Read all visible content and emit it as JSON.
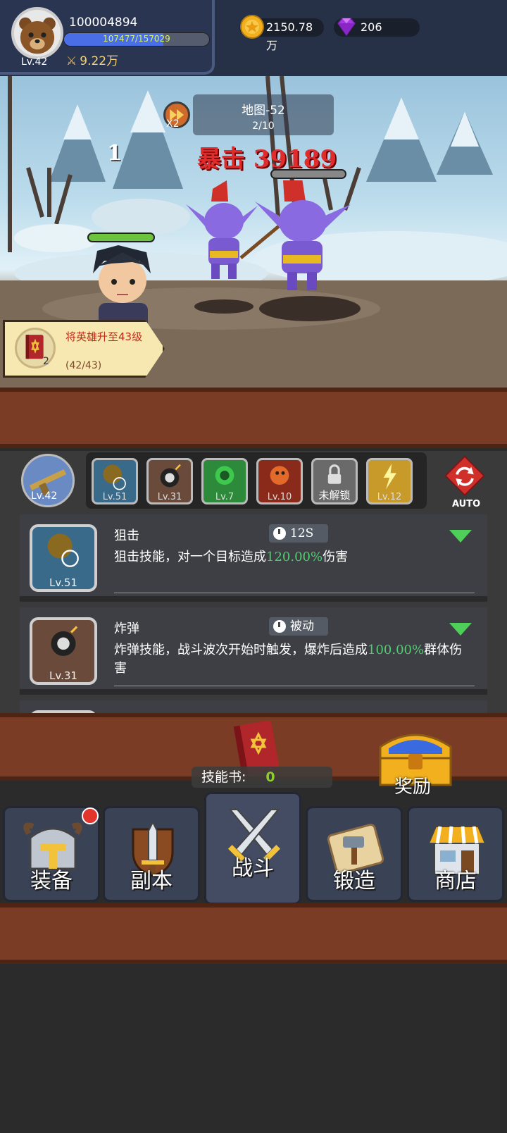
{
  "player": {
    "id": "100004894",
    "level": "Lv.42",
    "exp_text": "107477/157029",
    "exp_fraction": 0.6845,
    "power": "9.22万"
  },
  "resources": {
    "gold": "2150.78万",
    "gems": "206"
  },
  "battle": {
    "speed": "X2",
    "map_name": "地图-52",
    "wave": "2/10",
    "damage_small": "1",
    "damage_crit": "暴击 39189"
  },
  "quest": {
    "title": "将英雄升至43级",
    "count": "2",
    "progress": "(42/43)"
  },
  "skills": {
    "weapon_level": "Lv.42",
    "slots": [
      {
        "label": "Lv.51",
        "icon": "sniper-icon"
      },
      {
        "label": "Lv.31",
        "icon": "bomb-icon"
      },
      {
        "label": "Lv.7",
        "icon": "poison-icon"
      },
      {
        "label": "Lv.10",
        "icon": "fire-icon"
      },
      {
        "label": "未解锁",
        "icon": "lock-icon"
      },
      {
        "label": "Lv.12",
        "icon": "lightning-icon"
      }
    ],
    "auto_label": "AUTO",
    "list": [
      {
        "name": "狙击",
        "level": "Lv.51",
        "cooldown": "12S",
        "desc_prefix": "狙击技能，对一个目标造成",
        "desc_value": "120.00%",
        "desc_suffix": "伤害"
      },
      {
        "name": "炸弹",
        "level": "Lv.31",
        "cooldown": "被动",
        "desc_prefix": "炸弹技能，战斗波次开始时触发，爆炸后造成",
        "desc_value": "100.00%",
        "desc_suffix": "群体伤害"
      }
    ]
  },
  "rewards": {
    "skillbook_label": "技能书:",
    "skillbook_value": "0",
    "reward_label": "奖励"
  },
  "nav": {
    "items": [
      {
        "label": "装备",
        "icon": "helmet-icon"
      },
      {
        "label": "副本",
        "icon": "sword-shield-icon"
      },
      {
        "label": "战斗",
        "icon": "crossed-swords-icon"
      },
      {
        "label": "锻造",
        "icon": "scroll-hammer-icon"
      },
      {
        "label": "商店",
        "icon": "shop-icon"
      }
    ]
  },
  "colors": {
    "crit": "#e02c2c",
    "percent": "#4ecf6e",
    "wood": "#7a3c24"
  }
}
